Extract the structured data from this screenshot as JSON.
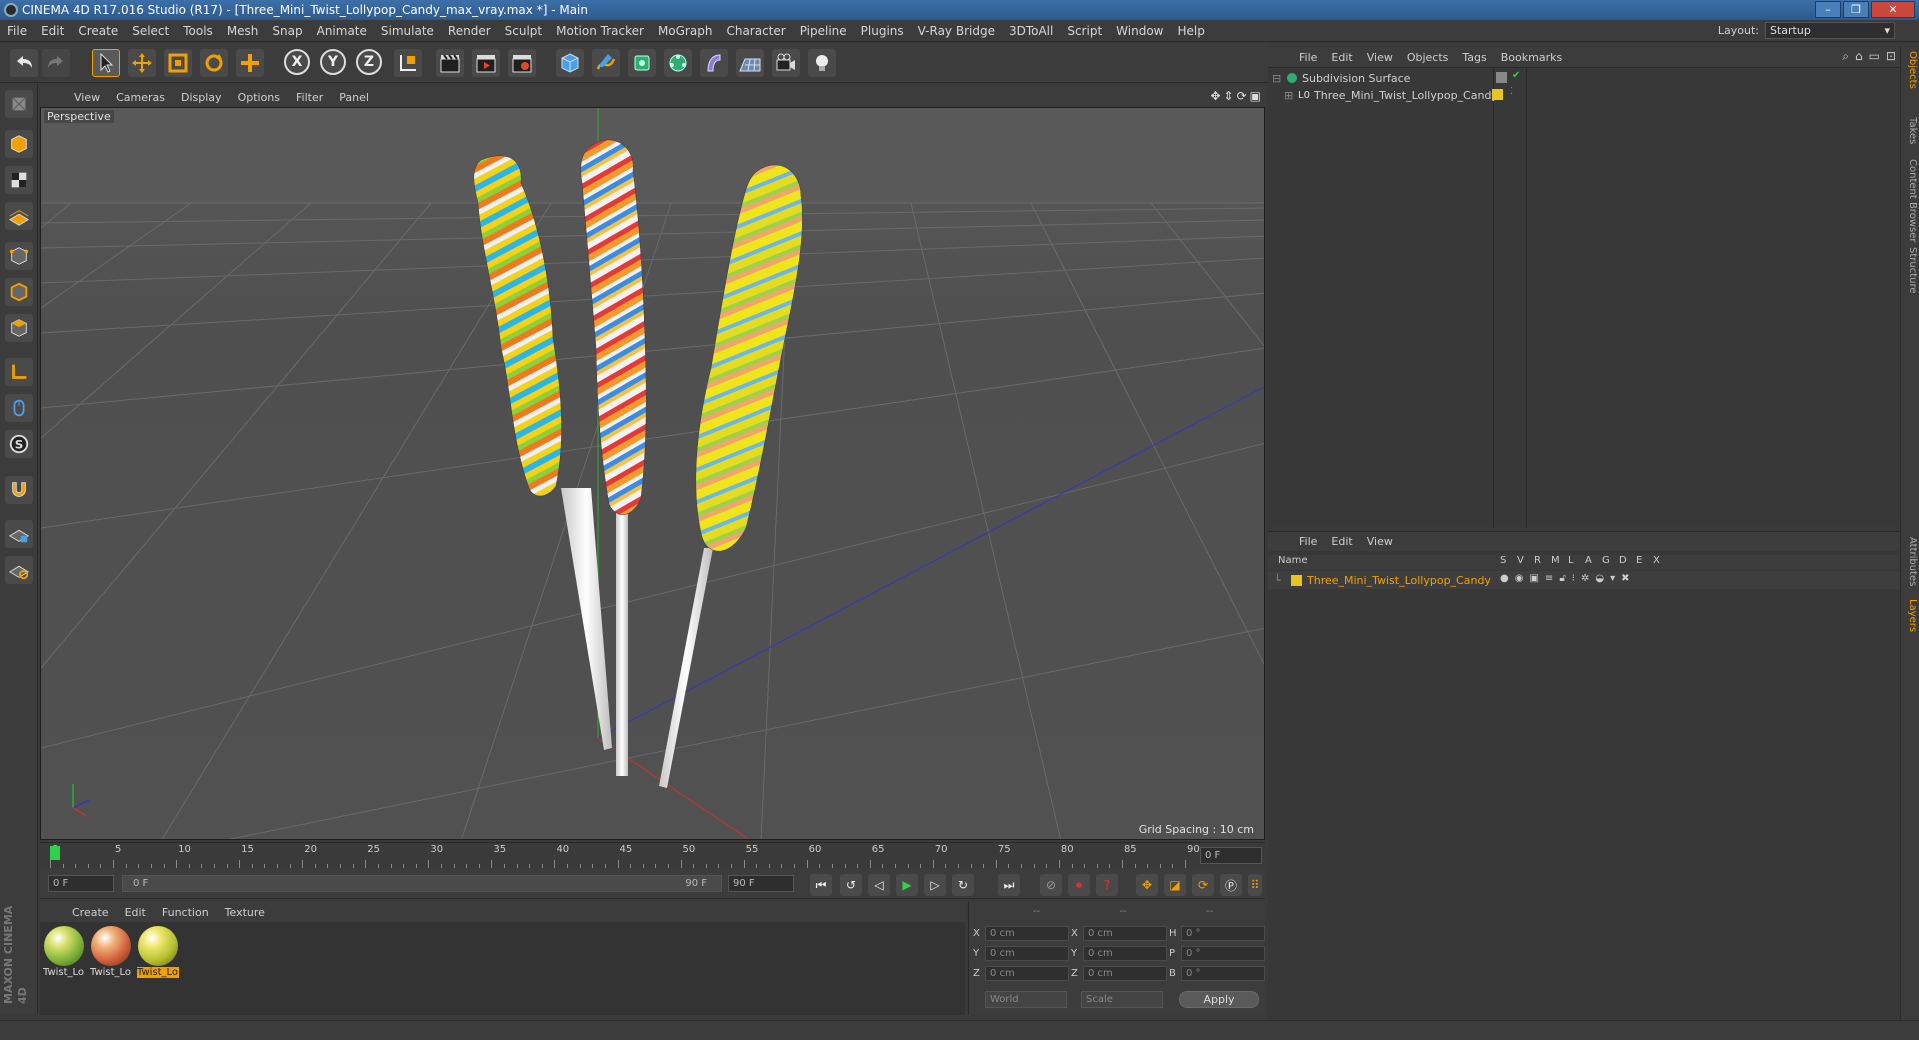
{
  "window": {
    "title": "CINEMA 4D R17.016 Studio (R17) - [Three_Mini_Twist_Lollypop_Candy_max_vray.max *] - Main"
  },
  "menubar": {
    "items": [
      "File",
      "Edit",
      "Create",
      "Select",
      "Tools",
      "Mesh",
      "Snap",
      "Animate",
      "Simulate",
      "Render",
      "Sculpt",
      "Motion Tracker",
      "MoGraph",
      "Character",
      "Pipeline",
      "Plugins",
      "V-Ray Bridge",
      "3DToAll",
      "Script",
      "Window",
      "Help"
    ],
    "layout_label": "Layout:",
    "layout_value": "Startup"
  },
  "toolbar": {
    "axis_x": "X",
    "axis_y": "Y",
    "axis_z": "Z"
  },
  "viewport": {
    "menu": [
      "View",
      "Cameras",
      "Display",
      "Options",
      "Filter",
      "Panel"
    ],
    "label": "Perspective",
    "grid_spacing": "Grid Spacing : 10 cm"
  },
  "timeline": {
    "ticks": [
      "0",
      "5",
      "10",
      "15",
      "20",
      "25",
      "30",
      "35",
      "40",
      "45",
      "50",
      "55",
      "60",
      "65",
      "70",
      "75",
      "80",
      "85",
      "90"
    ],
    "frame_end_field": "0 F",
    "current_frame": "0 F",
    "range_start": "0 F",
    "range_end": "90 F",
    "max_frame": "90 F"
  },
  "material_manager": {
    "menu": [
      "Create",
      "Edit",
      "Function",
      "Texture"
    ],
    "materials": [
      {
        "label": "Twist_Lo",
        "selected": false
      },
      {
        "label": "Twist_Lo",
        "selected": false
      },
      {
        "label": "Twist_Lo",
        "selected": true
      }
    ]
  },
  "coordinates": {
    "header": [
      "--",
      "--",
      "--"
    ],
    "rows": [
      {
        "a": "X",
        "av": "0 cm",
        "b": "X",
        "bv": "0 cm",
        "c": "H",
        "cv": "0 °"
      },
      {
        "a": "Y",
        "av": "0 cm",
        "b": "Y",
        "bv": "0 cm",
        "c": "P",
        "cv": "0 °"
      },
      {
        "a": "Z",
        "av": "0 cm",
        "b": "Z",
        "bv": "0 cm",
        "c": "B",
        "cv": "0 °"
      }
    ],
    "space": "World",
    "mode": "Scale",
    "apply": "Apply"
  },
  "object_manager": {
    "menu": [
      "File",
      "Edit",
      "View",
      "Objects",
      "Tags",
      "Bookmarks"
    ],
    "objects": [
      {
        "name": "Subdivision Surface",
        "icon": "subdivision-icon"
      },
      {
        "name": "Three_Mini_Twist_Lollypop_Candy",
        "icon": "null-object-icon"
      }
    ]
  },
  "layer_manager": {
    "menu": [
      "File",
      "Edit",
      "View"
    ],
    "columns": [
      "Name",
      "S",
      "V",
      "R",
      "M",
      "L",
      "A",
      "G",
      "D",
      "E",
      "X"
    ],
    "layers": [
      {
        "name": "Three_Mini_Twist_Lollypop_Candy",
        "color": "#e6c51e"
      }
    ]
  },
  "right_tabs": [
    "Objects",
    "Takes",
    "Content Browser",
    "Structure",
    "Attributes",
    "Layers"
  ],
  "logo": {
    "text": "MAXON CINEMA 4D"
  },
  "colors": {
    "accent": "#f2a000",
    "layer_yellow": "#e6c51e",
    "axis_green": "#2fae2f",
    "axis_blue": "#3535c8",
    "axis_red": "#c83030"
  }
}
